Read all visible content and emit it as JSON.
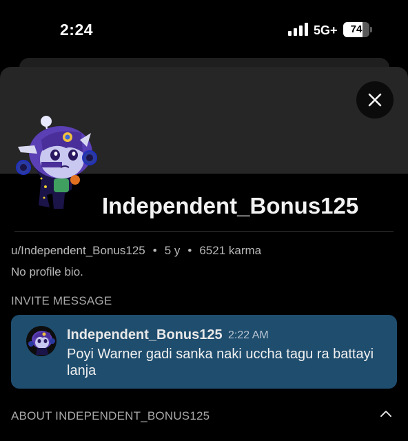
{
  "status_bar": {
    "time": "2:24",
    "network": "5G+",
    "battery": "74",
    "battery_level": 0.74
  },
  "profile": {
    "username": "Independent_Bonus125",
    "handle": "u/Independent_Bonus125",
    "age": "5 y",
    "karma": "6521 karma",
    "separator": "•",
    "bio": "No profile bio."
  },
  "invite": {
    "section_label": "INVITE MESSAGE",
    "author": "Independent_Bonus125",
    "time": "2:22 AM",
    "text": "Poyi Warner gadi sanka naki uccha tagu ra battayi lanja"
  },
  "about": {
    "section_label": "ABOUT INDEPENDENT_BONUS125"
  },
  "colors": {
    "invite_card": "#1f4d6e",
    "banner": "#262626",
    "avatar_purple": "#5b3fb4"
  }
}
